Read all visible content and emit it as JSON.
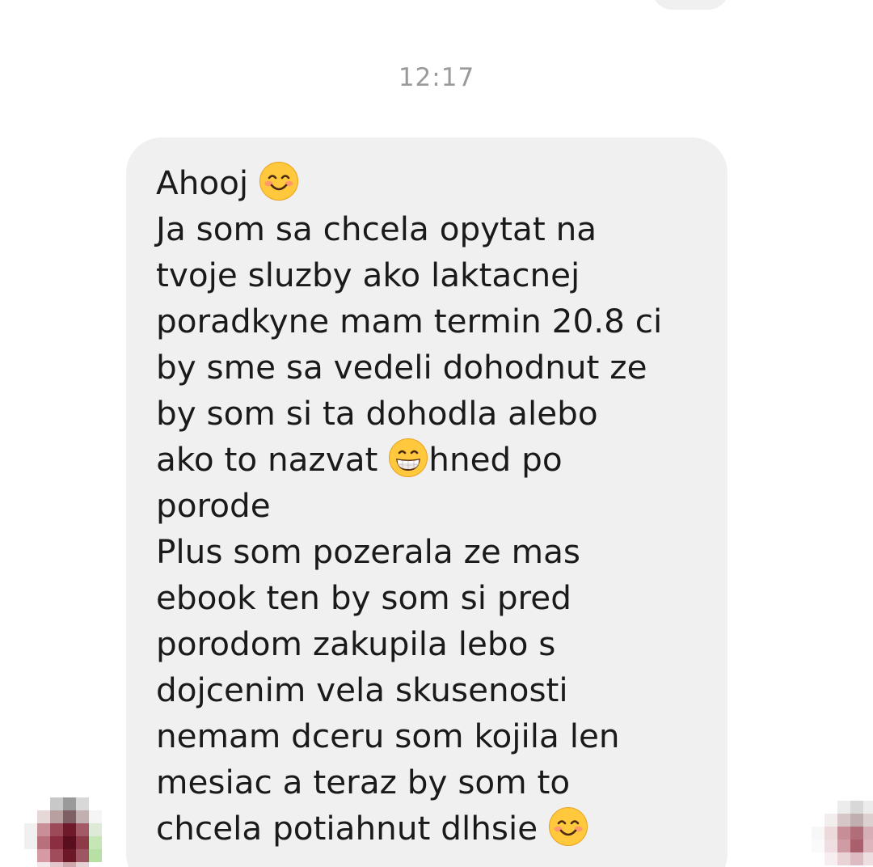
{
  "timestamp": "12:17",
  "message": {
    "lines": [
      {
        "text": "Ahooj ",
        "emoji": "smiling-face-with-smiling-eyes-icon"
      },
      {
        "text": "Ja som sa chcela opytat na"
      },
      {
        "text": "tvoje sluzby ako laktacnej"
      },
      {
        "text": "poradkyne mam termin 20.8 ci"
      },
      {
        "text": "by sme sa vedeli dohodnut ze"
      },
      {
        "text": "by som si ta dohodla alebo"
      },
      {
        "text": "ako to nazvat ",
        "emoji": "grinning-face-icon",
        "after": "hned po"
      },
      {
        "text": "porode"
      },
      {
        "text": "Plus som pozerala ze mas"
      },
      {
        "text": "ebook ten by som si pred"
      },
      {
        "text": "porodom zakupila lebo s"
      },
      {
        "text": "dojcenim vela skusenosti"
      },
      {
        "text": "nemam dceru som kojila len"
      },
      {
        "text": "mesiac a teraz by som to"
      },
      {
        "text": "chcela potiahnut dlhsie ",
        "emoji": "smiling-face-with-smiling-eyes-icon"
      }
    ]
  },
  "colors": {
    "bubble_bg": "#f0f0f0",
    "text": "#1a1a1a",
    "timestamp": "#9a9a9a",
    "emoji_face": "#ffc83d"
  },
  "avatars": {
    "left": {
      "pixels": [
        "#ffffff",
        "#ffffff",
        "#c8c8c8",
        "#9a9a9a",
        "#d8d8d8",
        "#ffffff",
        "#ffffff",
        "#e7d8d8",
        "#b9a0a0",
        "#7e5f63",
        "#c2b0b0",
        "#f5f5f5",
        "#f0f0f0",
        "#c98f98",
        "#9c4a58",
        "#6f1a2a",
        "#a35a66",
        "#dfe9d8",
        "#f0f0f0",
        "#b8707c",
        "#8c2e42",
        "#5a0f1e",
        "#8e3a48",
        "#c5e6b5",
        "#ffffff",
        "#d59aa3",
        "#a04c5a",
        "#6c1826",
        "#9e5662",
        "#b9e0a4",
        "#ffffff",
        "#f3e8ea",
        "#e2c7cc",
        "#cfa8ae",
        "#e5d2d5",
        "#ffffff"
      ]
    },
    "right": {
      "pixels": [
        "#ffffff",
        "#ffffff",
        "#ececec",
        "#d8d8d8",
        "#ececec",
        "#ffffff",
        "#ffffff",
        "#f2eeee",
        "#d6c6c8",
        "#c0aeb0",
        "#dcd0d1",
        "#ffffff",
        "#f7f7f7",
        "#ecd9dc",
        "#c88e98",
        "#b06e7a",
        "#d6aeb5",
        "#ffffff",
        "#fafafa",
        "#f0dfe2",
        "#cf9ba4",
        "#a9606c",
        "#dcb6bc",
        "#ffffff",
        "#ffffff",
        "#f6eef0",
        "#e9d3d7",
        "#dcbcc2",
        "#eddfe1",
        "#ffffff",
        "#ffffff",
        "#ffffff",
        "#ffffff",
        "#ffffff",
        "#ffffff",
        "#ffffff"
      ]
    }
  }
}
